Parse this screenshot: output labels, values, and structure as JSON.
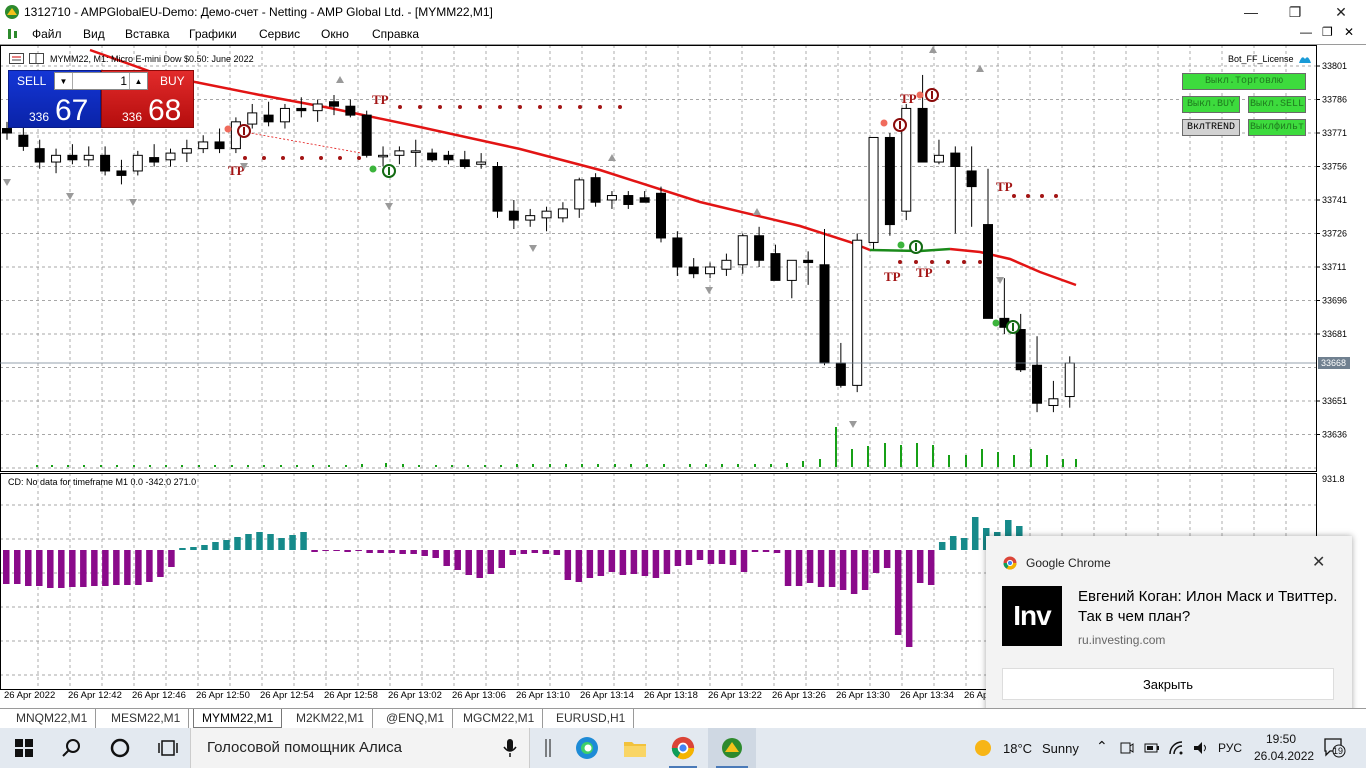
{
  "window": {
    "title": "1312710 - AMPGlobalEU-Demo: Демо-счет - Netting - AMP Global Ltd. - [MYMM22,M1]",
    "minimize_icon": "minimize-icon",
    "maximize_icon": "restore-icon",
    "close_icon": "close-icon"
  },
  "menu": {
    "items": [
      "Файл",
      "Вид",
      "Вставка",
      "Графики",
      "Сервис",
      "Окно",
      "Справка"
    ],
    "mdi_controls": [
      "minimize-icon",
      "restore-icon",
      "close-icon"
    ]
  },
  "chart": {
    "header": "MYMM22, M1:  Micro E-mini Dow $0.50: June 2022",
    "ea_label": "Bot_FF_License",
    "current_price": "33668",
    "price_labels": [
      "33801",
      "33786",
      "33771",
      "33756",
      "33741",
      "33726",
      "33711",
      "33696",
      "33681",
      "33651",
      "33636"
    ],
    "time_labels": [
      "26 Apr 2022",
      "26 Apr 12:42",
      "26 Apr 12:46",
      "26 Apr 12:50",
      "26 Apr 12:54",
      "26 Apr 12:58",
      "26 Apr 13:02",
      "26 Apr 13:06",
      "26 Apr 13:10",
      "26 Apr 13:14",
      "26 Apr 13:18",
      "26 Apr 13:22",
      "26 Apr 13:26",
      "26 Apr 13:30",
      "26 Apr 13:34",
      "26 Apr"
    ],
    "tp_label": "TP",
    "indicator_text": "CD: No data for timeframe M1 0.0 -342.0 271.0",
    "indicator_max_label": "931.8",
    "colors": {
      "bull": "#ffffff",
      "bear": "#000000",
      "ma": "#e21414",
      "ma_flat": "#1a8a1a",
      "tp": "#a31515",
      "volume": "#16a016",
      "histo_pos": "#168a8a",
      "histo_neg": "#8a0a8a",
      "grid": "#8a8a8a"
    }
  },
  "trade_panel": {
    "sell_label": "SELL",
    "buy_label": "BUY",
    "lot": "1",
    "sell_price_small": "336",
    "sell_price_big": "67",
    "buy_price_small": "336",
    "buy_price_big": "68"
  },
  "controls": {
    "trading_off": "Выкл.Торговлю",
    "buy_off": "Выкл.BUY",
    "sell_off": "Выкл.SELL",
    "trend_on": "ВклTREND",
    "filter_off": "Выклфильт"
  },
  "notification": {
    "source": "Google Chrome",
    "logo_text": "Inv",
    "headline": "Евгений Коган: Илон Маск и Твиттер. Так в чем план?",
    "url": "ru.investing.com",
    "close_button": "Закрыть"
  },
  "chart_tabs": [
    "MNQM22,M1",
    "MESM22,M1",
    "MYMM22,M1",
    "M2KM22,M1",
    "@ENQ,M1",
    "MGCM22,M1",
    "EURUSD,H1"
  ],
  "active_tab": "MYMM22,M1",
  "taskbar": {
    "search_placeholder": "Голосовой помощник Алиса",
    "weather_temp": "18°C",
    "weather_text": "Sunny",
    "language": "РУС",
    "time": "19:50",
    "date": "26.04.2022",
    "notifications_count": "19"
  }
}
